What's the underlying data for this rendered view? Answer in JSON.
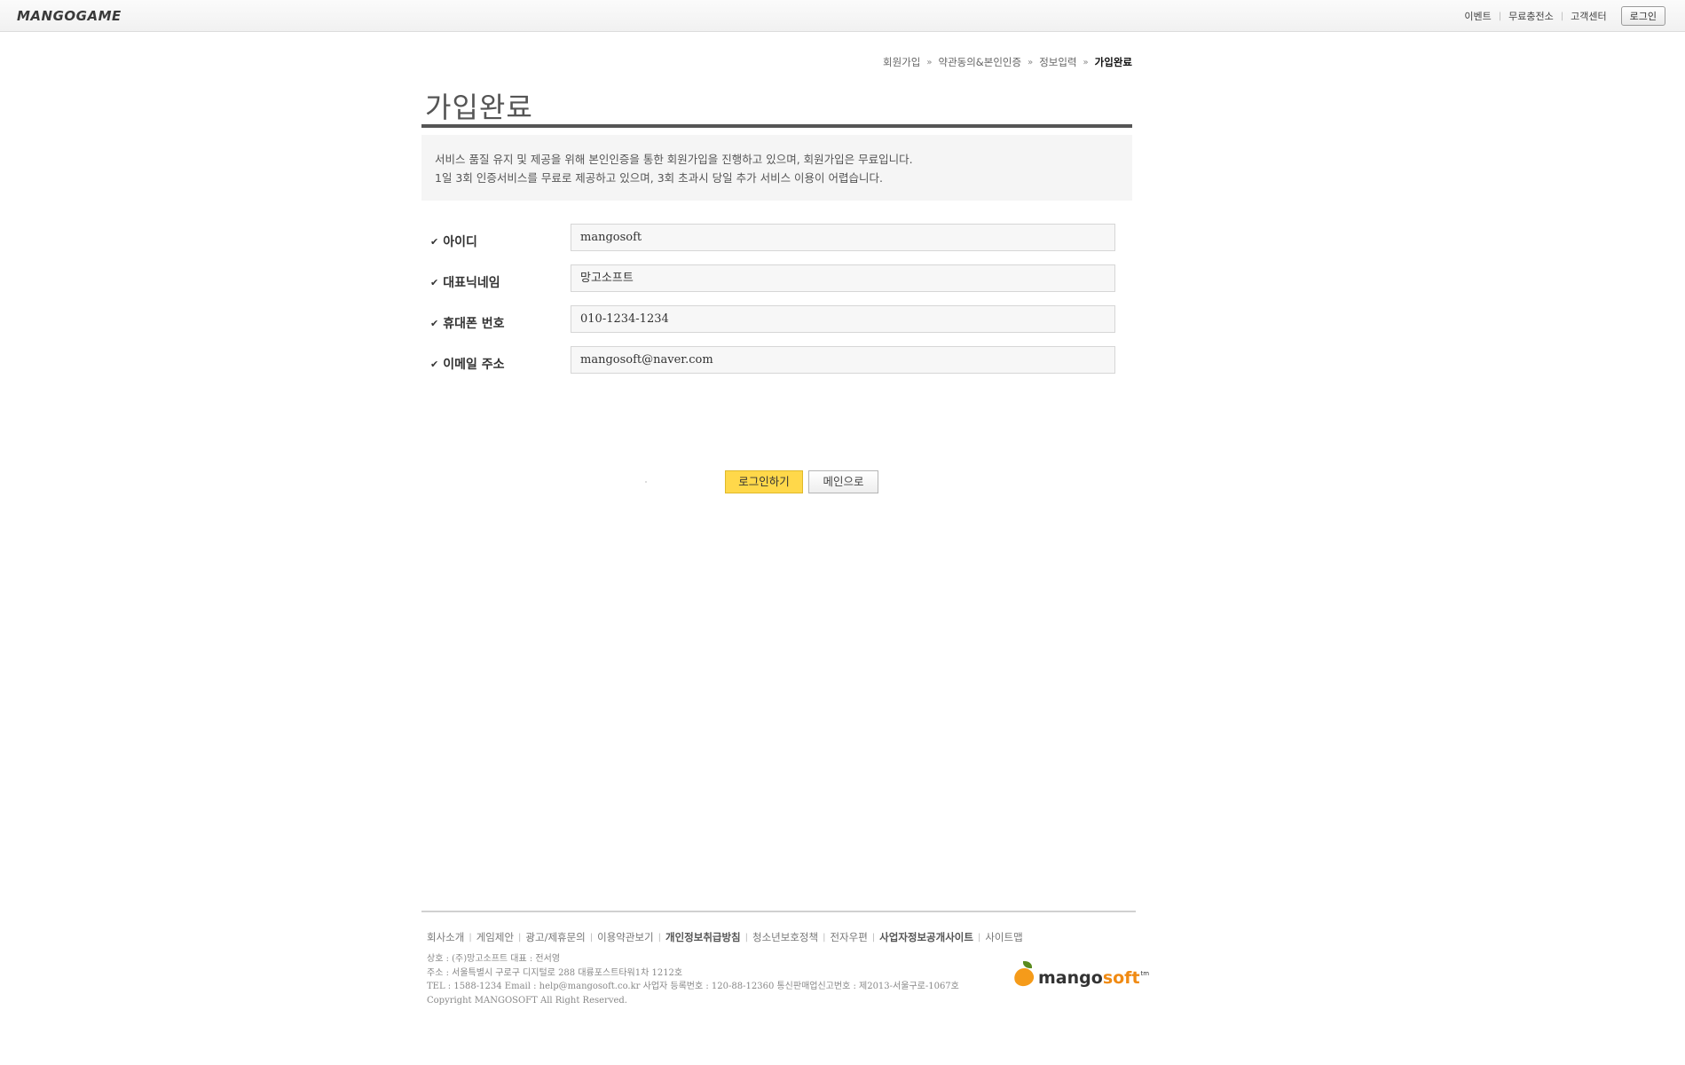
{
  "header": {
    "logo": "MANGOGAME",
    "nav": [
      "이벤트",
      "무료충전소",
      "고객센터"
    ],
    "login_label": "로그인"
  },
  "breadcrumb": {
    "steps": [
      "회원가입",
      "약관동의&본인인증",
      "정보입력"
    ],
    "current": "가입완료"
  },
  "page": {
    "title": "가입완료",
    "notice_line1": "서비스 품질 유지 및 제공을 위해 본인인증을 통한 회원가입을 진행하고 있으며, 회원가입은 무료입니다.",
    "notice_line2": "1일 3회 인증서비스를 무료로 제공하고 있으며, 3회 초과시 당일 추가 서비스 이용이 어렵습니다."
  },
  "form": {
    "id_label": "아이디",
    "id_value": "mangosoft",
    "nickname_label": "대표닉네임",
    "nickname_value": "망고소프트",
    "phone_label": "휴대폰 번호",
    "phone_value": "010-1234-1234",
    "email_label": "이메일 주소",
    "email_value": "mangosoft@naver.com"
  },
  "buttons": {
    "login": "로그인하기",
    "main": "메인으로"
  },
  "footer": {
    "links": [
      "회사소개",
      "게임제안",
      "광고/제휴문의",
      "이용약관보기",
      "개인정보취급방침",
      "청소년보호정책",
      "전자우편",
      "사업자정보공개사이트",
      "사이트맵"
    ],
    "info_company": "상호 : (주)망고소프트 대표 : 전서영",
    "info_address": "주소 : 서울특별시 구로구 디지털로 288 대륭포스트타워1차 1212호",
    "info_contact": "TEL : 1588-1234 Email : help@mangosoft.co.kr 사업자 등록번호 : 120-88-12360 통신판매업신고번호 : 제2013-서울구로-1067호",
    "copyright": "Copyright MANGOSOFT All Right Reserved.",
    "logo_part1": "mango",
    "logo_part2": "soft",
    "logo_tm": "tm"
  },
  "colors": {
    "accent_button": "#ffd84a",
    "title_rule": "#555555",
    "logo_orange": "#f08a12"
  }
}
